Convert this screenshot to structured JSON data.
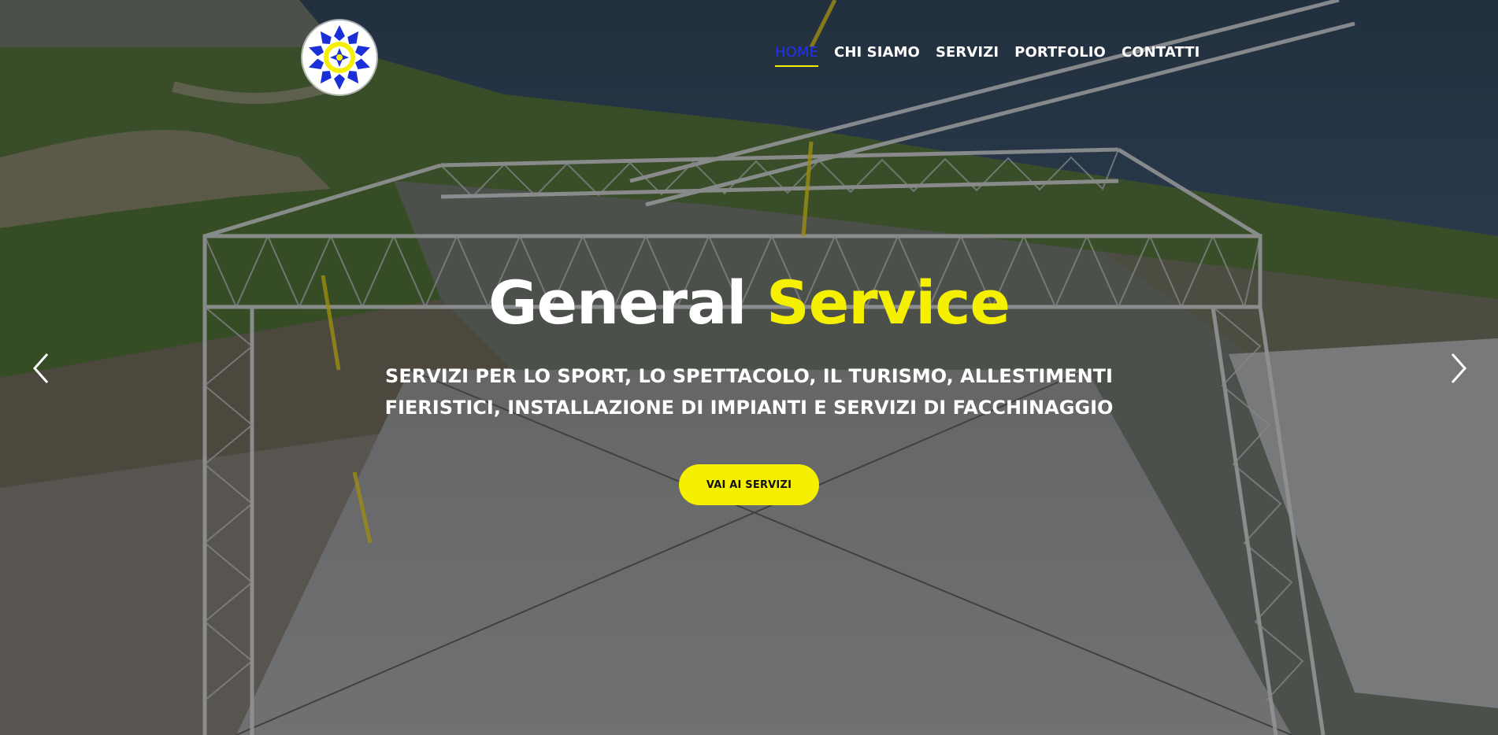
{
  "nav": {
    "items": [
      {
        "label": "HOME",
        "active": true
      },
      {
        "label": "CHI SIAMO",
        "active": false
      },
      {
        "label": "SERVIZI",
        "active": false
      },
      {
        "label": "PORTFOLIO",
        "active": false
      },
      {
        "label": "CONTATTI",
        "active": false
      }
    ]
  },
  "hero": {
    "title_main": "General",
    "title_accent": "Service",
    "subtitle_line1": "SERVIZI PER LO SPORT, LO SPETTACOLO, IL TURISMO, ALLESTIMENTI",
    "subtitle_line2": "FIERISTICI, INSTALLAZIONE DI IMPIANTI E SERVIZI DI FACCHINAGGIO",
    "cta_label": "VAI AI SERVIZI"
  },
  "icons": {
    "prev": "chevron-left-icon",
    "next": "chevron-right-icon",
    "logo": "company-logo"
  },
  "colors": {
    "accent": "#f5f000",
    "nav_active": "#2233ee",
    "text": "#ffffff"
  }
}
